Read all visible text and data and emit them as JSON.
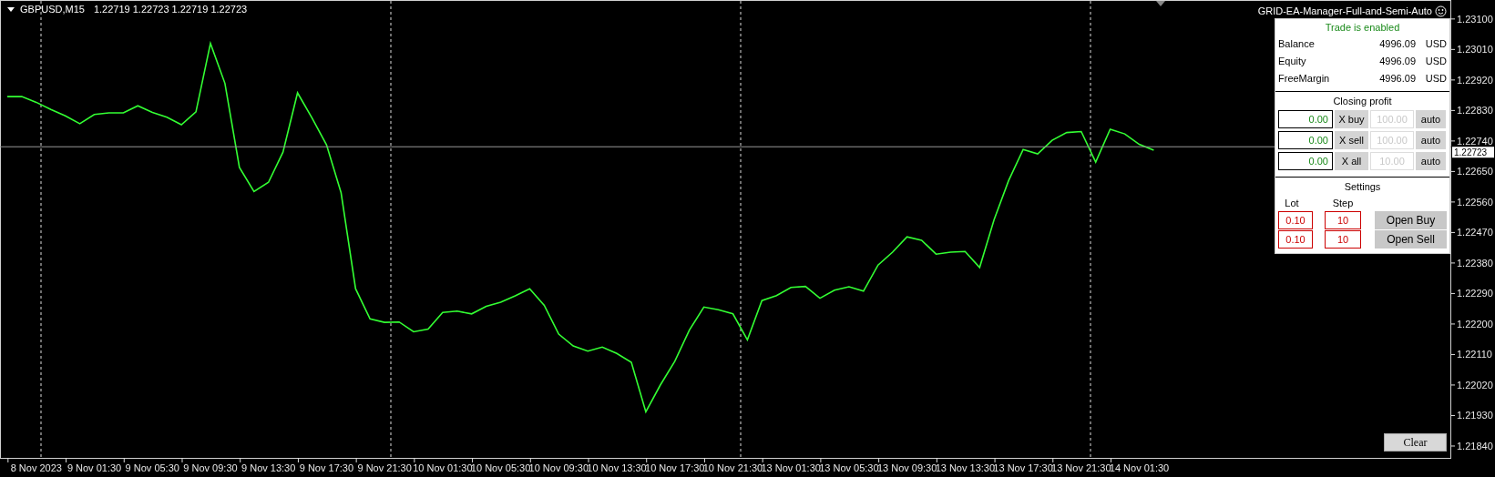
{
  "chart": {
    "ohlc": "1.22719 1.22723 1.22719 1.22723",
    "chart_data": {
      "type": "line",
      "ylim": [
        1.21805,
        1.23156
      ],
      "categories": [
        null,
        null,
        "8 Nov 2023",
        null,
        null,
        null,
        "9 Nov 01:30",
        null,
        null,
        null,
        "9 Nov 05:30",
        null,
        null,
        null,
        "9 Nov 09:30",
        null,
        null,
        null,
        "9 Nov 13:30",
        null,
        null,
        null,
        "9 Nov 17:30",
        null,
        null,
        null,
        "9 Nov 21:30",
        null,
        null,
        null,
        "10 Nov 01:30",
        null,
        null,
        null,
        "10 Nov 05:30",
        null,
        null,
        null,
        "10 Nov 09:30",
        null,
        null,
        null,
        "10 Nov 13:30",
        null,
        null,
        null,
        "10 Nov 17:30",
        null,
        null,
        null,
        "10 Nov 21:30",
        null,
        null,
        null,
        "13 Nov 01:30",
        null,
        null,
        null,
        "13 Nov 05:30",
        null,
        null,
        null,
        "13 Nov 09:30",
        null,
        null,
        null,
        "13 Nov 13:30",
        null,
        null,
        null,
        "13 Nov 17:30",
        null,
        null,
        null,
        "13 Nov 21:30",
        null,
        null,
        null,
        "14 Nov 01:30",
        null,
        null,
        null,
        null,
        null,
        null,
        null,
        null,
        null,
        null,
        null,
        null,
        null,
        null,
        null,
        null,
        null,
        null,
        null,
        null,
        null
      ],
      "yticks": [
        {
          "value": 1.231,
          "label": "1.23100"
        },
        {
          "value": 1.2301,
          "label": "1.23010"
        },
        {
          "value": 1.2292,
          "label": "1.22920"
        },
        {
          "value": 1.2283,
          "label": "1.22830"
        },
        {
          "value": 1.2274,
          "label": "1.22740"
        },
        {
          "value": 1.2265,
          "label": "1.22650"
        },
        {
          "value": 1.2256,
          "label": "1.22560"
        },
        {
          "value": 1.2247,
          "label": "1.22470"
        },
        {
          "value": 1.2238,
          "label": "1.22380"
        },
        {
          "value": 1.2229,
          "label": "1.22290"
        },
        {
          "value": 1.222,
          "label": "1.22200"
        },
        {
          "value": 1.2211,
          "label": "1.22110"
        },
        {
          "value": 1.2202,
          "label": "1.22020"
        },
        {
          "value": 1.2193,
          "label": "1.21930"
        },
        {
          "value": 1.2184,
          "label": "1.21840"
        }
      ],
      "series": [
        {
          "name": "GBPUSD,M15",
          "color": "#33ff33",
          "values": [
            1.22871,
            1.22871,
            1.22854,
            1.22833,
            1.22814,
            1.22791,
            1.22818,
            1.22823,
            1.22823,
            1.22844,
            1.22824,
            1.2281,
            1.22788,
            1.22826,
            1.23028,
            1.2291,
            1.22662,
            1.22591,
            1.22618,
            1.22707,
            1.22882,
            1.22808,
            1.22729,
            1.22587,
            1.22304,
            1.22215,
            1.22205,
            1.22206,
            1.22177,
            1.22185,
            1.22234,
            1.22238,
            1.2223,
            1.22252,
            1.22264,
            1.22283,
            1.22304,
            1.22255,
            1.2217,
            1.22135,
            1.2212,
            1.22132,
            1.22113,
            1.22087,
            1.21941,
            1.2202,
            1.2209,
            1.22182,
            1.2225,
            1.22242,
            1.2223,
            1.22153,
            1.22269,
            1.22284,
            1.22308,
            1.22311,
            1.22276,
            1.223,
            1.2231,
            1.22297,
            1.22374,
            1.22412,
            1.22457,
            1.22447,
            1.22406,
            1.22412,
            1.22414,
            1.22367,
            1.22508,
            1.22623,
            1.22715,
            1.22702,
            1.22742,
            1.22765,
            1.22768,
            1.22678,
            1.22775,
            1.22761,
            1.2273,
            1.22713,
            null,
            null,
            null,
            null,
            null,
            null,
            null,
            null,
            null,
            null,
            null,
            null,
            null,
            null,
            null,
            null,
            null,
            null,
            null,
            null
          ]
        }
      ],
      "ref_lines": [
        {
          "axis": "y",
          "value": 1.22723,
          "label": "1.22723"
        }
      ]
    }
  },
  "ea_panel": {
    "title": "GRID-EA-Manager-Full-and-Semi-Auto",
    "status": "Trade is enabled",
    "account": [
      {
        "label": "Balance",
        "value": "4996.09",
        "currency": "USD"
      },
      {
        "label": "Equity",
        "value": "4996.09",
        "currency": "USD"
      },
      {
        "label": "FreeMargin",
        "value": "4996.09",
        "currency": "USD"
      }
    ],
    "closing_profit": {
      "title": "Closing profit",
      "rows": [
        {
          "profit": "0.00",
          "button": "X buy",
          "target": "100.00",
          "disabled": true,
          "auto": "auto"
        },
        {
          "profit": "0.00",
          "button": "X sell",
          "target": "100.00",
          "disabled": true,
          "auto": "auto"
        },
        {
          "profit": "0.00",
          "button": "X all",
          "target": "10.00",
          "disabled": true,
          "auto": "auto"
        }
      ]
    },
    "settings": {
      "title": "Settings",
      "lot_label": "Lot",
      "step_label": "Step",
      "rows": [
        {
          "lot": "0.10",
          "step": "10",
          "button": "Open Buy"
        },
        {
          "lot": "0.10",
          "step": "10",
          "button": "Open Sell"
        }
      ]
    }
  },
  "clear_button": "Clear"
}
